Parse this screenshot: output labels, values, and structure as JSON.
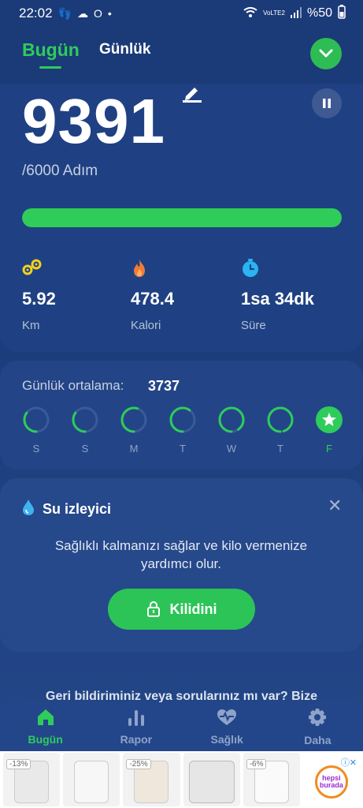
{
  "status_bar": {
    "time": "22:02",
    "battery": "%50",
    "network": "VoLTE2",
    "left_icons": [
      "steps-icon",
      "drop-icon",
      "cloud-icon",
      "o-icon",
      "dot-icon"
    ]
  },
  "header": {
    "tab_today": "Bugün",
    "tab_daily": "Günlük"
  },
  "steps": {
    "value": "9391",
    "goal": "/6000 Adım",
    "progress_fraction": 1.0
  },
  "stats": [
    {
      "value": "5.92",
      "label": "Km",
      "icon": "distance-icon",
      "color": "#f4d21f"
    },
    {
      "value": "478.4",
      "label": "Kalori",
      "icon": "flame-icon",
      "color": "#f47b36"
    },
    {
      "value": "1sa 34dk",
      "label": "Süre",
      "icon": "clock-icon",
      "color": "#2ab4f2"
    }
  ],
  "daily_average": {
    "label": "Günlük ortalama:",
    "value": "3737",
    "days": [
      {
        "label": "S",
        "fraction": 0.35
      },
      {
        "label": "S",
        "fraction": 0.35
      },
      {
        "label": "M",
        "fraction": 0.55
      },
      {
        "label": "T",
        "fraction": 0.6
      },
      {
        "label": "W",
        "fraction": 0.9
      },
      {
        "label": "T",
        "fraction": 0.95
      },
      {
        "label": "F",
        "fraction": 1.0,
        "star": true
      }
    ]
  },
  "water": {
    "title": "Su izleyici",
    "description": "Sağlıklı kalmanızı sağlar ve kilo vermenize yardımcı olur.",
    "unlock_label": "Kilidini"
  },
  "feedback_text": "Geri bildiriminiz veya sorularınız mı var? Bize",
  "nav": [
    {
      "label": "Bugün",
      "icon": "home-icon",
      "active": true
    },
    {
      "label": "Rapor",
      "icon": "bar-chart-icon"
    },
    {
      "label": "Sağlık",
      "icon": "heart-pulse-icon"
    },
    {
      "label": "Daha",
      "icon": "gear-icon"
    }
  ],
  "ad": {
    "badges": [
      "-13%",
      "",
      "-25%",
      "",
      "-6%"
    ],
    "logo_text": "hepsi burada"
  },
  "colors": {
    "accent": "#2ecc5b",
    "background": "#1c3c7a"
  }
}
